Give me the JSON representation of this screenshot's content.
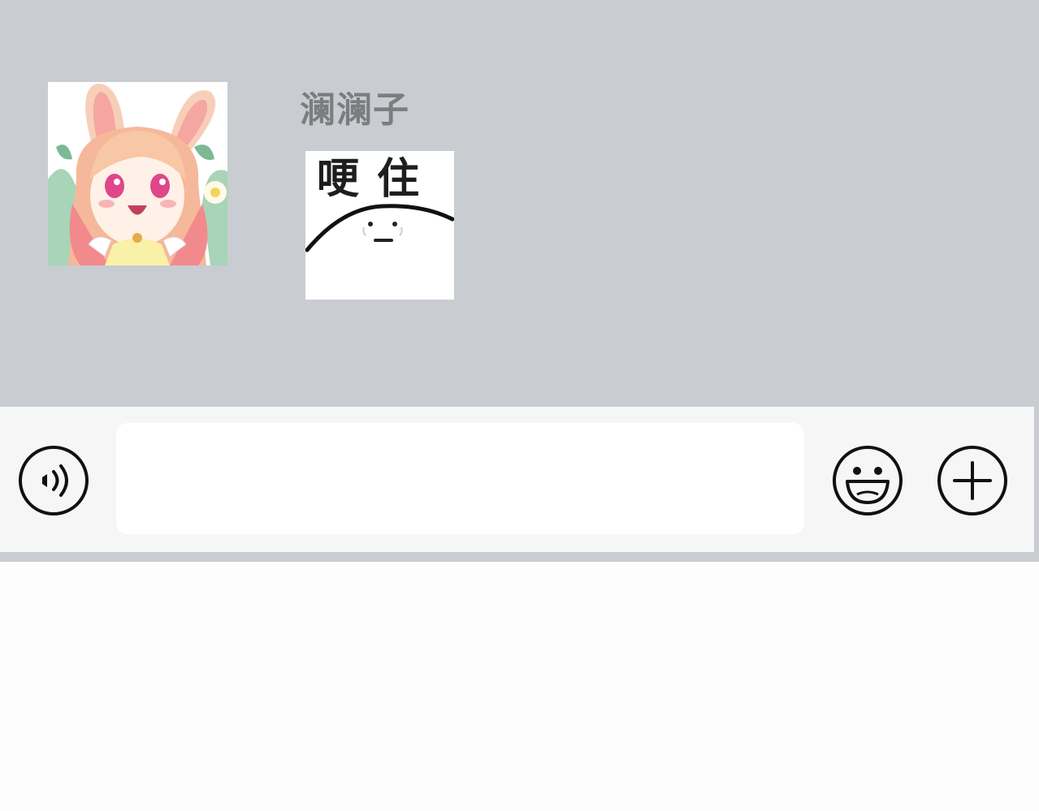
{
  "chat": {
    "message": {
      "sender_name": "澜澜子",
      "sticker_text": "哽住"
    }
  },
  "input_bar": {
    "text_value": "",
    "placeholder": ""
  },
  "icons": {
    "voice": "voice-icon",
    "emoji": "emoji-icon",
    "plus": "plus-icon"
  },
  "colors": {
    "chat_background": "#c9ccd1",
    "input_bar_background": "#f6f6f6",
    "sender_name": "#7c7d80"
  }
}
